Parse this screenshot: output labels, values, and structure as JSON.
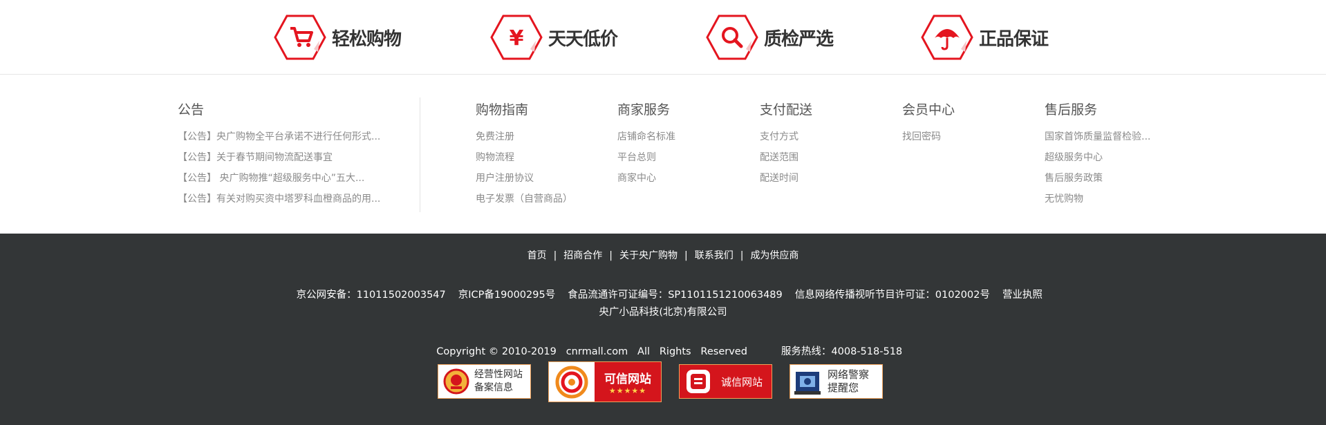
{
  "features": [
    {
      "label": "轻松购物",
      "icon": "shopping-cart-icon"
    },
    {
      "label": "天天低价",
      "icon": "yen-icon"
    },
    {
      "label": "质检严选",
      "icon": "magnifier-icon"
    },
    {
      "label": "正品保证",
      "icon": "umbrella-icon"
    }
  ],
  "colors": {
    "accent": "#e4151f",
    "footer_bg": "#333637",
    "link": "#8a8a8a"
  },
  "columns": {
    "notice": {
      "title": "公告",
      "items": [
        "【公告】央广购物全平台承诺不进行任何形式...",
        "【公告】关于春节期间物流配送事宜",
        "【公告】 央广购物推“超级服务中心”五大...",
        "【公告】有关对购买资中塔罗科血橙商品的用..."
      ]
    },
    "guide": {
      "title": "购物指南",
      "items": [
        "免费注册",
        "购物流程",
        "用户注册协议",
        "电子发票（自营商品）"
      ]
    },
    "merchant": {
      "title": "商家服务",
      "items": [
        "店铺命名标准",
        "平台总则",
        "商家中心"
      ]
    },
    "payment": {
      "title": "支付配送",
      "items": [
        "支付方式",
        "配送范围",
        "配送时间"
      ]
    },
    "member": {
      "title": "会员中心",
      "items": [
        "找回密码"
      ]
    },
    "aftersale": {
      "title": "售后服务",
      "items": [
        "国家首饰质量监督检验...",
        "超级服务中心",
        "售后服务政策",
        "无忧购物"
      ]
    }
  },
  "footer": {
    "nav": [
      "首页",
      "招商合作",
      "关于央广购物",
      "联系我们",
      "成为供应商"
    ],
    "separator": "|",
    "licenses": [
      "京公网安备：11011502003547",
      "京ICP备19000295号",
      "食品流通许可证编号：SP1101151210063489",
      "信息网络传播视听节目许可证：0102002号",
      "营业执照"
    ],
    "company": "央广小品科技(北京)有限公司",
    "copyright": "Copyright © 2010-2019   cnrmall.com   All   Rights   Reserved",
    "hotline": "服务热线：4008-518-518",
    "badges": {
      "b1": {
        "line1": "经营性网站",
        "line2": "备案信息"
      },
      "b2": {
        "label": "可信网站",
        "stars": "★★★★★"
      },
      "b3": {
        "label": "诚信网站"
      },
      "b4": {
        "line1": "网络警察",
        "line2": "提醒您"
      }
    }
  }
}
